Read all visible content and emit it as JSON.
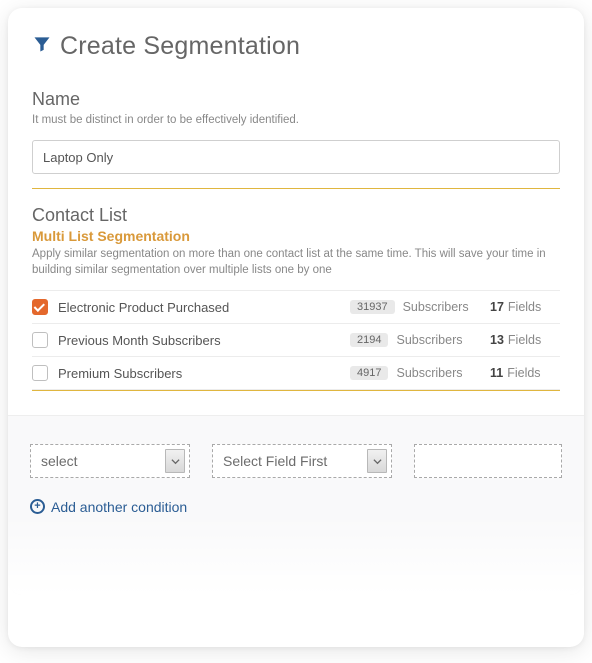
{
  "header": {
    "title": "Create Segmentation"
  },
  "name_section": {
    "label": "Name",
    "help": "It must be distinct in order to be effectively identified.",
    "value": "Laptop Only"
  },
  "contactlist_section": {
    "label": "Contact List",
    "subheading": "Multi List Segmentation",
    "help": "Apply similar segmentation on more than one contact list at the same time. This will save your time in building similar segmentation over multiple lists one by one",
    "subscribers_label": "Subscribers",
    "fields_label": "Fields",
    "lists": [
      {
        "name": "Electronic Product Purchased",
        "subscribers": "31937",
        "fields": "17",
        "checked": true
      },
      {
        "name": "Previous Month Subscribers",
        "subscribers": "2194",
        "fields": "13",
        "checked": false
      },
      {
        "name": "Premium Subscribers",
        "subscribers": "4917",
        "fields": "11",
        "checked": false
      }
    ]
  },
  "conditions": {
    "select_placeholder": "select",
    "operator_placeholder": "Select Field First",
    "value_placeholder": "",
    "add_label": "Add another condition"
  }
}
